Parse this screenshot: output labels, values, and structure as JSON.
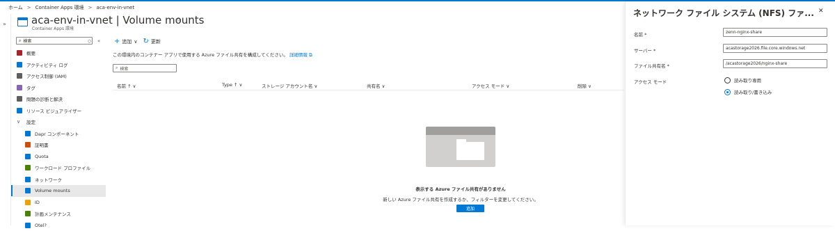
{
  "breadcrumb": [
    "ホーム",
    "Container Apps 環境",
    "aca-env-in-vnet"
  ],
  "header": {
    "title": "aca-env-in-vnet | Volume mounts",
    "subtitle": "Container Apps 環境",
    "star_icon": "☆",
    "more_icon": "···"
  },
  "nav": {
    "search_placeholder": "検索",
    "items": [
      {
        "label": "概要",
        "icon": "overview-icon",
        "color": "#a4262c"
      },
      {
        "label": "アクティビティ ログ",
        "icon": "activity-log-icon",
        "color": "#0078d4"
      },
      {
        "label": "アクセス制御 (IAM)",
        "icon": "iam-icon",
        "color": "#605e5c"
      },
      {
        "label": "タグ",
        "icon": "tag-icon",
        "color": "#8764b8"
      },
      {
        "label": "問題の診断と解決",
        "icon": "diagnose-icon",
        "color": "#605e5c"
      },
      {
        "label": "リソース ビジュアライザー",
        "icon": "visualizer-icon",
        "color": "#0078d4"
      },
      {
        "label": "設定",
        "icon": "chevron-down-icon",
        "color": "#605e5c"
      },
      {
        "label": "Dapr コンポーネント",
        "icon": "dapr-icon",
        "color": "#0078d4"
      },
      {
        "label": "証明書",
        "icon": "certificate-icon",
        "color": "#ca5010"
      },
      {
        "label": "Quota",
        "icon": "quota-icon",
        "color": "#0078d4"
      },
      {
        "label": "ワークロード プロファイル",
        "icon": "workload-icon",
        "color": "#498205"
      },
      {
        "label": "ネットワーク",
        "icon": "network-icon",
        "color": "#0078d4"
      },
      {
        "label": "Volume mounts",
        "icon": "volume-icon",
        "color": "#0078d4"
      },
      {
        "label": "ID",
        "icon": "identity-icon",
        "color": "#eaa300"
      },
      {
        "label": "計画メンテナンス",
        "icon": "maintenance-icon",
        "color": "#498205"
      },
      {
        "label": "Otel?",
        "icon": "otel-icon",
        "color": "#0078d4"
      }
    ]
  },
  "toolbar": {
    "add": "追加",
    "refresh": "更新"
  },
  "description": "この環境内のコンテナー アプリで使用する Azure ファイル共有を構成してください。",
  "learn_more": "詳細情報",
  "filter_placeholder": "検索",
  "table": {
    "columns": [
      "名前 ↑",
      "Type ↑",
      "ストレージ アカウント名",
      "共有名",
      "アクセス モード",
      "削除"
    ]
  },
  "empty": {
    "title": "表示する Azure ファイル共有がありません",
    "desc": "新しい Azure ファイル共有を作成するか、フィルターを変更してください。",
    "add": "追加"
  },
  "panel": {
    "title": "ネットワーク ファイル システム (NFS) ファ...",
    "fields": [
      {
        "label": "名前 *",
        "value": "zenn-nginx-share"
      },
      {
        "label": "サーバー *",
        "value": "acastorage2026.file.core.windows.net"
      },
      {
        "label": "ファイル共有名 *",
        "value": "/acastorage2026/nginx-share"
      }
    ],
    "access_label": "アクセス モード",
    "options": [
      "読み取り専用",
      "読み取り/書き込み"
    ],
    "selected": 1
  },
  "colors": {
    "accent": "#0078d4"
  }
}
